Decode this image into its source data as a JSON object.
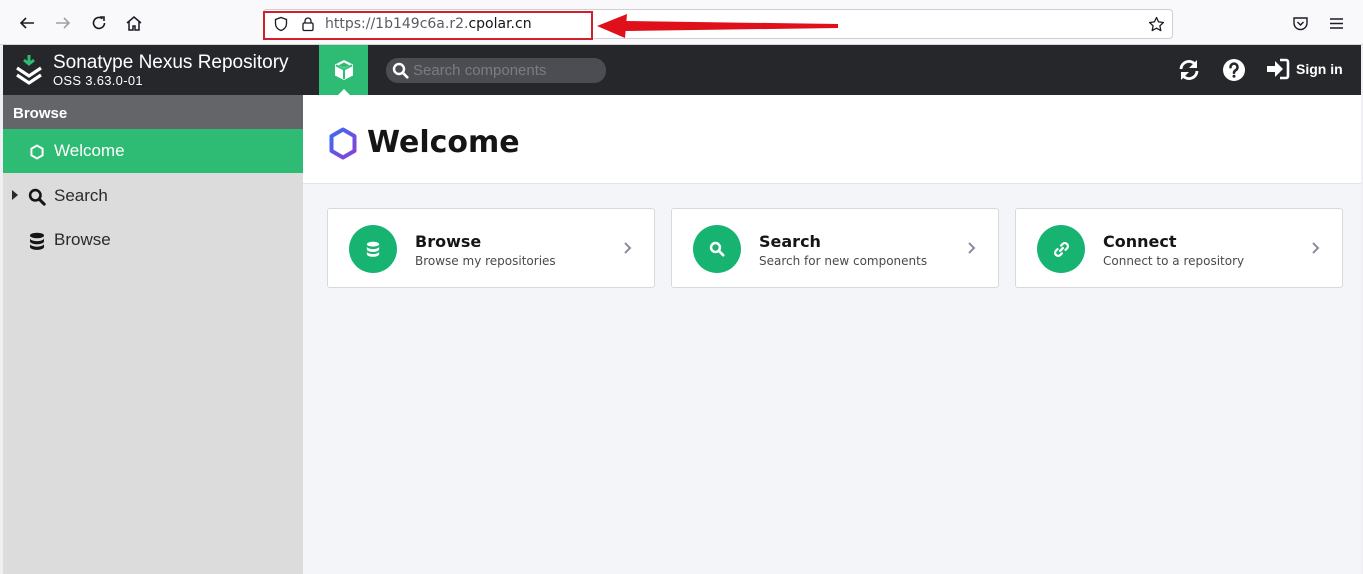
{
  "browser": {
    "url_prefix": "https://1b149c6a.r2.",
    "url_host": "cpolar.cn"
  },
  "header": {
    "title": "Sonatype Nexus Repository",
    "version": "OSS 3.63.0-01",
    "search_placeholder": "Search components",
    "sign_in_label": "Sign in"
  },
  "sidebar": {
    "header": "Browse",
    "items": [
      {
        "label": "Welcome",
        "icon": "hexagon-icon",
        "active": true
      },
      {
        "label": "Search",
        "icon": "search-icon",
        "active": false
      },
      {
        "label": "Browse",
        "icon": "database-icon",
        "active": false
      }
    ]
  },
  "main": {
    "title": "Welcome",
    "cards": [
      {
        "title": "Browse",
        "subtitle": "Browse my repositories",
        "icon": "database-icon"
      },
      {
        "title": "Search",
        "subtitle": "Search for new components",
        "icon": "search-icon"
      },
      {
        "title": "Connect",
        "subtitle": "Connect to a repository",
        "icon": "link-icon"
      }
    ]
  },
  "colors": {
    "accent_green": "#2ebb73",
    "header_dark": "#25272a",
    "highlight_red": "#d0202e"
  }
}
